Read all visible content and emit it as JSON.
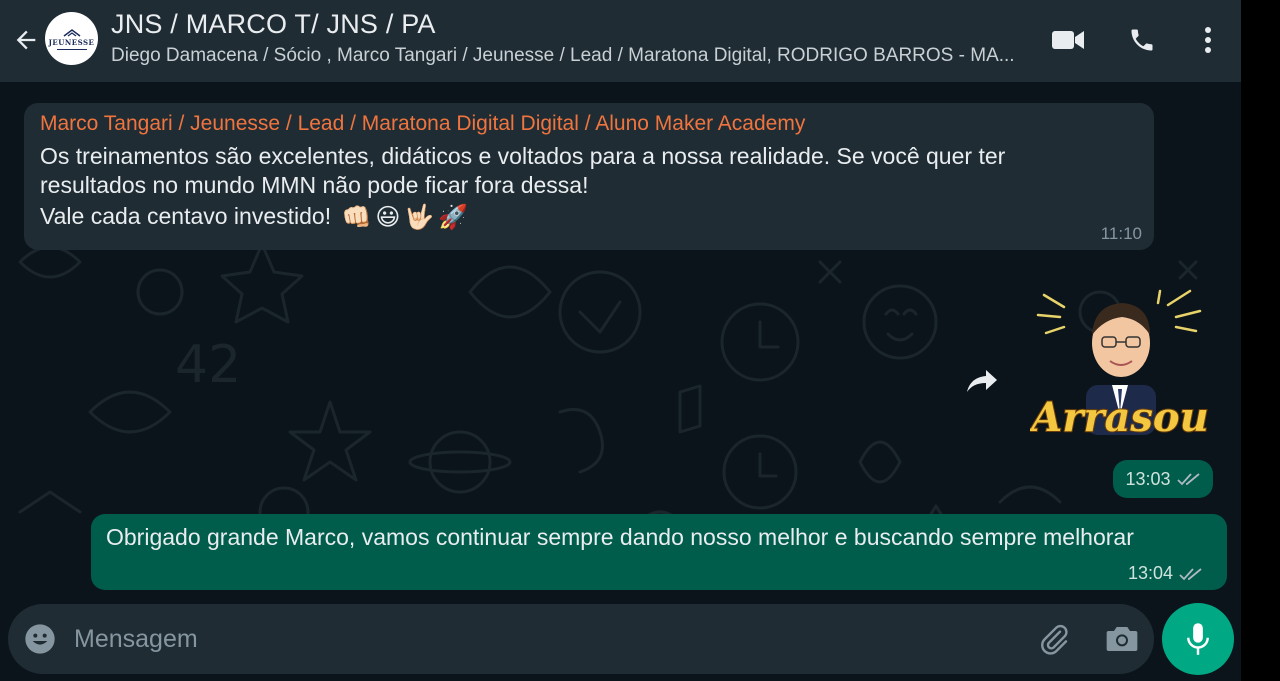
{
  "header": {
    "title": "JNS / MARCO T/ JNS / PA",
    "subtitle": "Diego Damacena / Sócio , Marco Tangari / Jeunesse / Lead / Maratona Digital, RODRIGO BARROS - MA...",
    "avatar_text": "JEUNESSE",
    "icons": [
      "back-arrow-icon",
      "video-call-icon",
      "phone-icon",
      "more-vertical-icon"
    ]
  },
  "messages": {
    "incoming": {
      "sender": "Marco Tangari / Jeunesse / Lead / Maratona Digital Digital / Aluno Maker Academy",
      "line1": "Os treinamentos são excelentes, didáticos e voltados para a nossa realidade. Se você quer ter",
      "line2": "resultados no mundo MMN não pode ficar fora dessa!",
      "line3": "Vale cada centavo investido!",
      "emojis": [
        "👊🏻",
        "😃",
        "🤟🏻",
        "🚀"
      ],
      "time": "11:10"
    },
    "sticker": {
      "caption": "Arrasou",
      "time": "13:03"
    },
    "outgoing": {
      "text": "Obrigado grande Marco, vamos continuar sempre dando nosso melhor e buscando sempre melhorar",
      "time": "13:04"
    }
  },
  "composer": {
    "placeholder": "Mensagem"
  },
  "colors": {
    "header_bg": "#1f2c34",
    "chat_bg": "#0b141a",
    "incoming_bubble": "#1f2c34",
    "outgoing_bubble": "#005c4b",
    "sender_name": "#f0743e",
    "accent": "#00a884"
  }
}
